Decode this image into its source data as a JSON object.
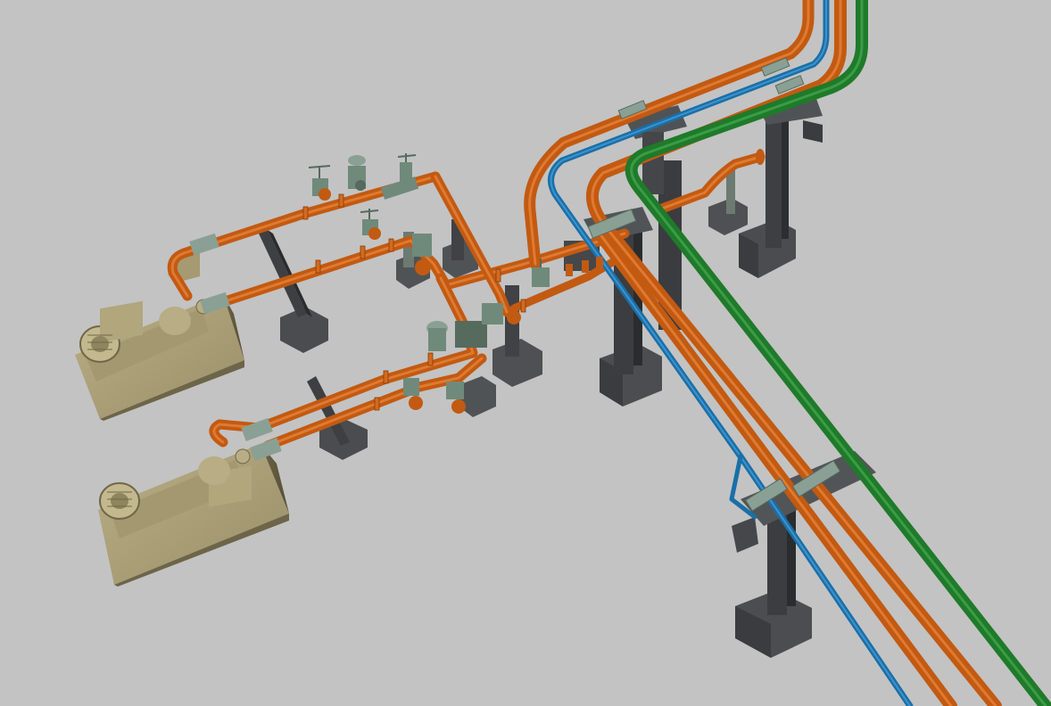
{
  "scene": {
    "colors": {
      "background": "#c3c3c3",
      "process_pipe": "#c25a12",
      "process_pipe_highlight": "#e07a30",
      "cooling_pipe": "#1a6fa8",
      "utility_pipe": "#1f7a2a",
      "steel_support": "#3f4144",
      "concrete_footing": "#55575a",
      "pump_skid": "#a89d76",
      "valve_body": "#6f8a7a"
    },
    "legend": {
      "pump-1": "pump-motor",
      "pump-2": "pump-motor",
      "pipe-rack": "steel-support",
      "valves": "gate-valve"
    }
  }
}
